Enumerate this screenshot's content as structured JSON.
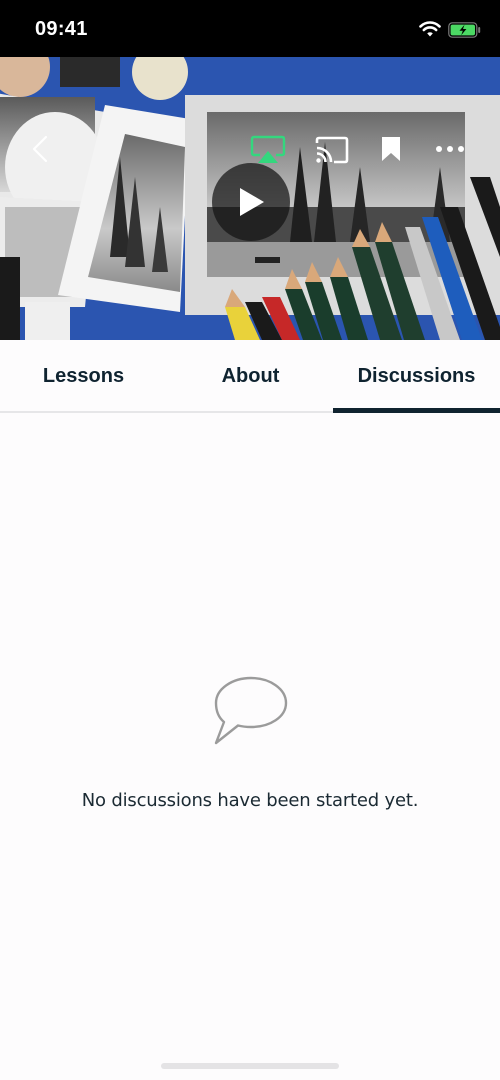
{
  "status_bar": {
    "time": "09:41",
    "icons": [
      "wifi-icon",
      "battery-charging-icon"
    ],
    "battery_color": "#4cd964"
  },
  "video_header": {
    "controls": [
      {
        "name": "back",
        "icon": "chevron-left-icon"
      },
      {
        "name": "airplay",
        "icon": "airplay-icon",
        "active": true,
        "color": "#34d77e"
      },
      {
        "name": "cast",
        "icon": "cast-icon"
      },
      {
        "name": "bookmark",
        "icon": "bookmark-icon"
      },
      {
        "name": "more",
        "icon": "more-horizontal-icon"
      }
    ],
    "play_icon": "play-icon"
  },
  "tabs": {
    "items": [
      {
        "label": "Lessons",
        "active": false
      },
      {
        "label": "About",
        "active": false
      },
      {
        "label": "Discussions",
        "active": true
      }
    ],
    "active_color": "#10232f"
  },
  "discussions": {
    "empty_icon": "speech-bubble-icon",
    "empty_message": "No discussions have been started yet."
  }
}
